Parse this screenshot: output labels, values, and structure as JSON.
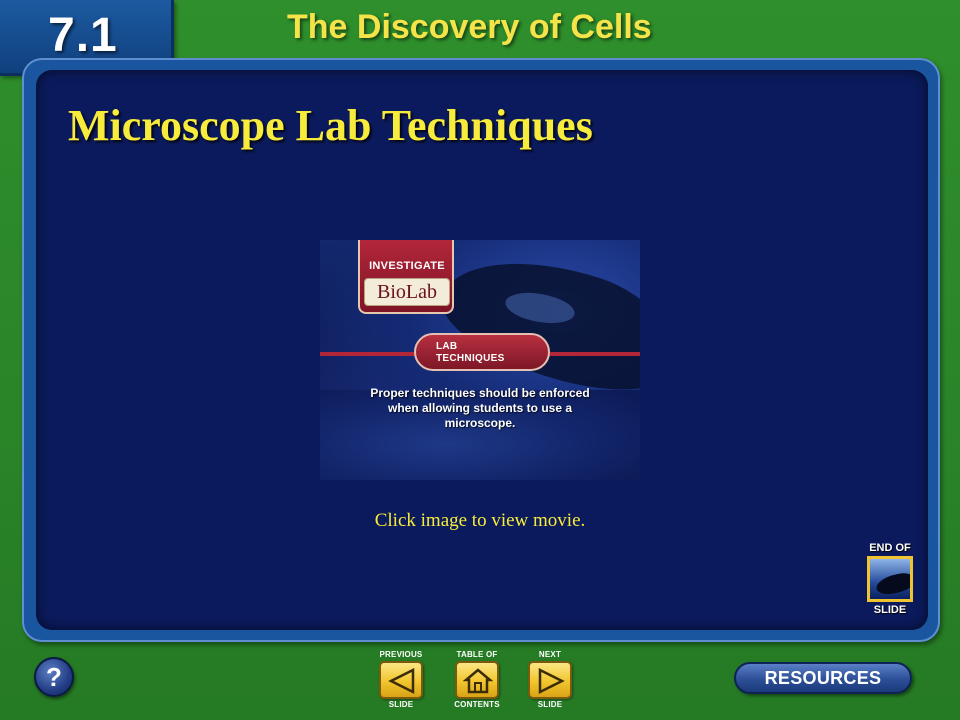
{
  "header": {
    "section_number": "7.1",
    "chapter_title": "The Discovery of Cells"
  },
  "slide": {
    "title": "Microscope Lab Techniques",
    "video": {
      "banner_top": "INVESTIGATE",
      "banner_bottom": "BioLab",
      "lab_line1": "LAB",
      "lab_line2": "TECHNIQUES",
      "caption": "Proper techniques should be enforced when allowing students to use a microscope."
    },
    "click_caption": "Click image to view movie."
  },
  "end_of_slide": {
    "top": "END OF",
    "bottom": "SLIDE"
  },
  "help": {
    "label": "?"
  },
  "nav": {
    "previous": {
      "top": "PREVIOUS",
      "bottom": "SLIDE",
      "icon": "left-arrow-icon"
    },
    "contents": {
      "top": "TABLE OF",
      "bottom": "CONTENTS",
      "icon": "home-icon"
    },
    "next": {
      "top": "NEXT",
      "bottom": "SLIDE",
      "icon": "right-arrow-icon"
    }
  },
  "resources": {
    "label": "RESOURCES"
  },
  "colors": {
    "background_green": "#2d8a2b",
    "panel_navy": "#0b1a5c",
    "title_yellow": "#f7ec3c",
    "button_gold": "#f2c52d",
    "button_blue": "#2c4f97"
  }
}
